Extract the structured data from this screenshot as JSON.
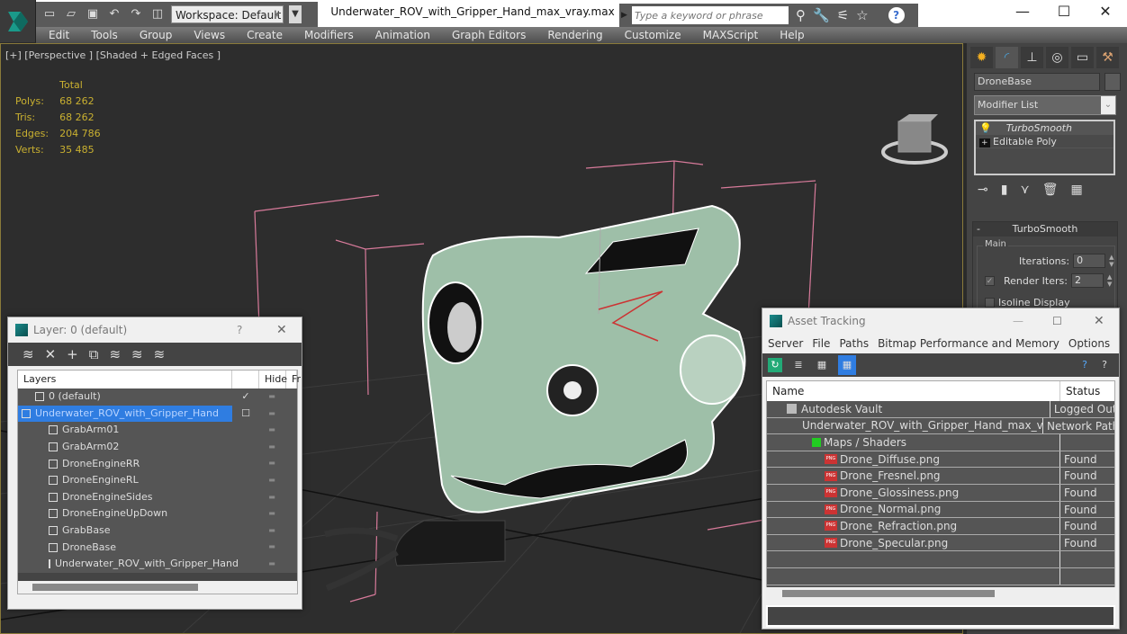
{
  "app": {
    "title": "Underwater_ROV_with_Gripper_Hand_max_vray.max",
    "workspace": "Workspace: Default",
    "search_placeholder": "Type a keyword or phrase",
    "accent_color": "#2f7de1",
    "quick_access_icons": [
      "new-file-icon",
      "open-file-icon",
      "save-icon",
      "undo-icon",
      "redo-icon",
      "project-icon"
    ],
    "search_tool_icons": [
      "binoculars-icon",
      "wrench-icon",
      "satellite-icon",
      "star-icon",
      "help-icon"
    ]
  },
  "menu": [
    "Edit",
    "Tools",
    "Group",
    "Views",
    "Create",
    "Modifiers",
    "Animation",
    "Graph Editors",
    "Rendering",
    "Customize",
    "MAXScript",
    "Help"
  ],
  "viewport": {
    "label": "[+] [Perspective ] [Shaded + Edged Faces ]",
    "stats_header": "Total",
    "stats": [
      {
        "label": "Polys:",
        "value": "68 262"
      },
      {
        "label": "Tris:",
        "value": "68 262"
      },
      {
        "label": "Edges:",
        "value": "204 786"
      },
      {
        "label": "Verts:",
        "value": "35 485"
      }
    ]
  },
  "command_panel": {
    "object_name": "DroneBase",
    "modifier_list": "Modifier List",
    "stack": [
      "TurboSmooth",
      "Editable Poly"
    ],
    "rollout_title": "TurboSmooth",
    "group_label": "Main",
    "iterations_label": "Iterations:",
    "iterations_value": "0",
    "render_iters_label": "Render Iters:",
    "render_iters_value": "2",
    "isoline_label": "Isoline Display"
  },
  "layer_dialog": {
    "title": "Layer: 0 (default)",
    "help": "?",
    "columns": {
      "layers": "Layers",
      "hide": "Hide",
      "freeze": "Fr"
    },
    "rows": [
      {
        "name": "0 (default)",
        "type": "layer",
        "indent": 1
      },
      {
        "name": "Underwater_ROV_with_Gripper_Hand",
        "type": "layer",
        "indent": 0,
        "selected": true
      },
      {
        "name": "GrabArm01",
        "type": "object",
        "indent": 2
      },
      {
        "name": "GrabArm02",
        "type": "object",
        "indent": 2
      },
      {
        "name": "DroneEngineRR",
        "type": "object",
        "indent": 2
      },
      {
        "name": "DroneEngineRL",
        "type": "object",
        "indent": 2
      },
      {
        "name": "DroneEngineSides",
        "type": "object",
        "indent": 2
      },
      {
        "name": "DroneEngineUpDown",
        "type": "object",
        "indent": 2
      },
      {
        "name": "GrabBase",
        "type": "object",
        "indent": 2
      },
      {
        "name": "DroneBase",
        "type": "object",
        "indent": 2
      },
      {
        "name": "Underwater_ROV_with_Gripper_Hand",
        "type": "object",
        "indent": 2
      }
    ]
  },
  "asset_dialog": {
    "title": "Asset Tracking",
    "menu": [
      "Server",
      "File",
      "Paths",
      "Bitmap Performance and Memory",
      "Options"
    ],
    "columns": {
      "name": "Name",
      "status": "Status"
    },
    "rows": [
      {
        "name": "Autodesk Vault",
        "status": "Logged Out",
        "indent": 1,
        "icon": "vault-icon"
      },
      {
        "name": "Underwater_ROV_with_Gripper_Hand_max_vray.max",
        "status": "Network Path",
        "indent": 2,
        "icon": "max-file-icon"
      },
      {
        "name": "Maps / Shaders",
        "status": "",
        "indent": 3,
        "icon": "maps-icon"
      },
      {
        "name": "Drone_Diffuse.png",
        "status": "Found",
        "indent": 4,
        "icon": "png-icon"
      },
      {
        "name": "Drone_Fresnel.png",
        "status": "Found",
        "indent": 4,
        "icon": "png-icon"
      },
      {
        "name": "Drone_Glossiness.png",
        "status": "Found",
        "indent": 4,
        "icon": "png-icon"
      },
      {
        "name": "Drone_Normal.png",
        "status": "Found",
        "indent": 4,
        "icon": "png-icon"
      },
      {
        "name": "Drone_Refraction.png",
        "status": "Found",
        "indent": 4,
        "icon": "png-icon"
      },
      {
        "name": "Drone_Specular.png",
        "status": "Found",
        "indent": 4,
        "icon": "png-icon"
      }
    ]
  }
}
